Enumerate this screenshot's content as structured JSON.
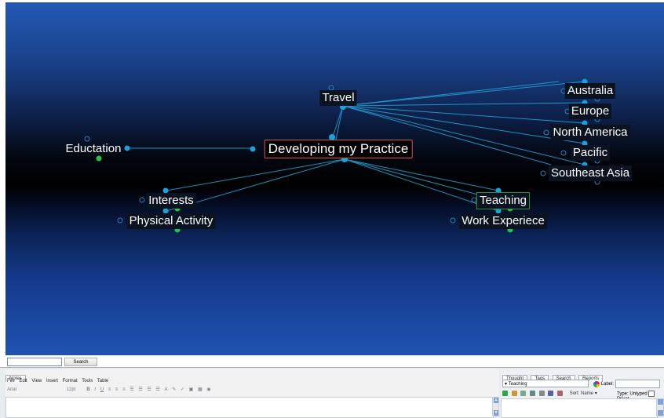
{
  "map": {
    "central": "Developing my Practice",
    "thoughts": {
      "travel": "Travel",
      "education": "Eductation",
      "interests": "Interests",
      "physical_activity": "Physical Activity",
      "teaching": "Teaching",
      "work_experience": "Work Experiece",
      "australia": "Australia",
      "europe": "Europe",
      "north_america": "North America",
      "pacific": "Pacific",
      "southeast_asia": "Southeast Asia"
    }
  },
  "search": {
    "value": "",
    "button": "Search"
  },
  "notes": {
    "tab": "Notes",
    "menu": [
      "File",
      "Edit",
      "View",
      "Insert",
      "Format",
      "Tools",
      "Table"
    ],
    "font": "Arial",
    "size": "12pt",
    "bold": "B",
    "italic": "I",
    "underline": "U"
  },
  "side": {
    "tabs": [
      "Thought",
      "Tags",
      "Search",
      "Reports"
    ],
    "selected_thought": "Teaching",
    "label_text": "Label:",
    "sort": "Sort: Name ▾",
    "type": "Type: Untyped",
    "private": "Privat"
  },
  "colors": {
    "link": "#23a7d8",
    "node": "#17a2e0",
    "child_node": "#22c44a",
    "central_border": "#d9534a"
  }
}
